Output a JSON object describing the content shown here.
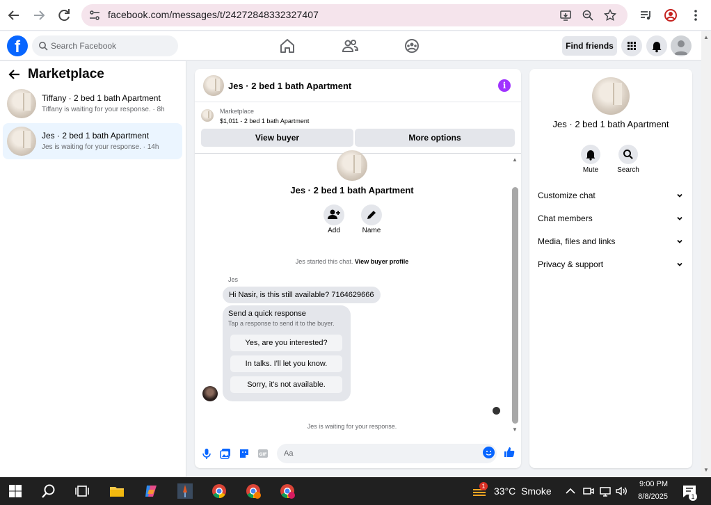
{
  "browser": {
    "url": "facebook.com/messages/t/24272848332327407"
  },
  "fb_header": {
    "search_placeholder": "Search Facebook",
    "find_friends": "Find friends"
  },
  "sidebar": {
    "title": "Marketplace",
    "conversations": [
      {
        "name": "Tiffany · 2 bed 1 bath Apartment",
        "status": "Tiffany is waiting for your response. · 8h"
      },
      {
        "name": "Jes · 2 bed 1 bath Apartment",
        "status": "Jes is waiting for your response. · 14h"
      }
    ]
  },
  "chat": {
    "title": "Jes · 2 bed 1 bath Apartment",
    "marketplace_label": "Marketplace",
    "listing": "$1,011 - 2 bed 1 bath Apartment",
    "view_buyer": "View buyer",
    "more_options": "More options",
    "profile_name": "Jes · 2 bed 1 bath Apartment",
    "add_label": "Add",
    "name_label": "Name",
    "started_text": "Jes started this chat.",
    "view_profile": "View buyer profile",
    "sender": "Jes",
    "message": "Hi Nasir, is this still available? 7164629666",
    "quick_title": "Send a quick response",
    "quick_sub": "Tap a response to send it to the buyer.",
    "quick_replies": [
      "Yes, are you interested?",
      "In talks. I'll let you know.",
      "Sorry, it's not available."
    ],
    "waiting": "Jes is waiting for your response.",
    "composer_placeholder": "Aa"
  },
  "details": {
    "name": "Jes · 2 bed 1 bath Apartment",
    "mute": "Mute",
    "search": "Search",
    "sections": [
      "Customize chat",
      "Chat members",
      "Media, files and links",
      "Privacy & support"
    ]
  },
  "taskbar": {
    "weather": "33°C  Smoke",
    "weather_badge": "1",
    "time": "9:00 PM",
    "date": "8/8/2025",
    "notif_count": "1"
  },
  "colors": {
    "fb_blue": "#0866ff",
    "info_purple": "#a033ff",
    "active_conv": "#ebf5ff"
  }
}
